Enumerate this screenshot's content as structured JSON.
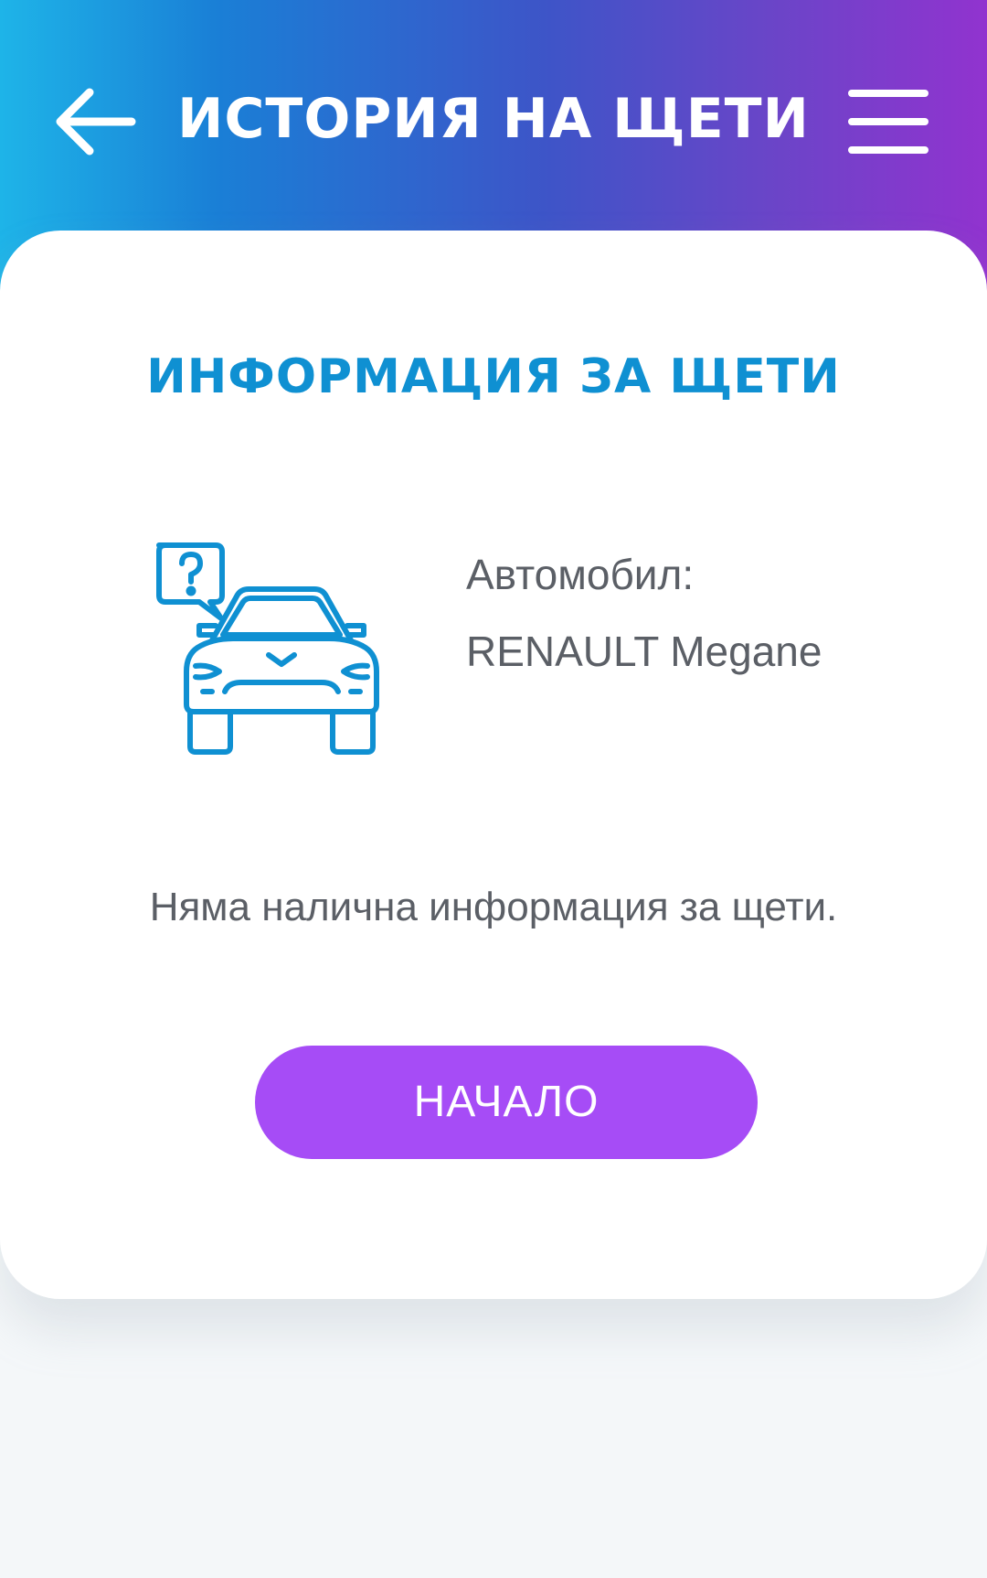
{
  "header": {
    "title": "ИСТОРИЯ НА ЩЕТИ",
    "back_icon": "arrow-left-icon",
    "menu_icon": "hamburger-menu-icon"
  },
  "card": {
    "title": "ИНФОРМАЦИЯ ЗА ЩЕТИ",
    "illustration_icon": "car-question-icon",
    "vehicle_label": "Автомобил:",
    "vehicle_value": "RENAULT Megane",
    "message": "Няма налична информация за щети.",
    "start_button_label": "НАЧАЛО"
  },
  "colors": {
    "header_gradient_start": "#1eb4e8",
    "header_gradient_end": "#9133cf",
    "title_blue": "#0f90d2",
    "button_purple": "#a64cf6",
    "text_gray": "#5b5f66",
    "background": "#f4f7f9"
  }
}
